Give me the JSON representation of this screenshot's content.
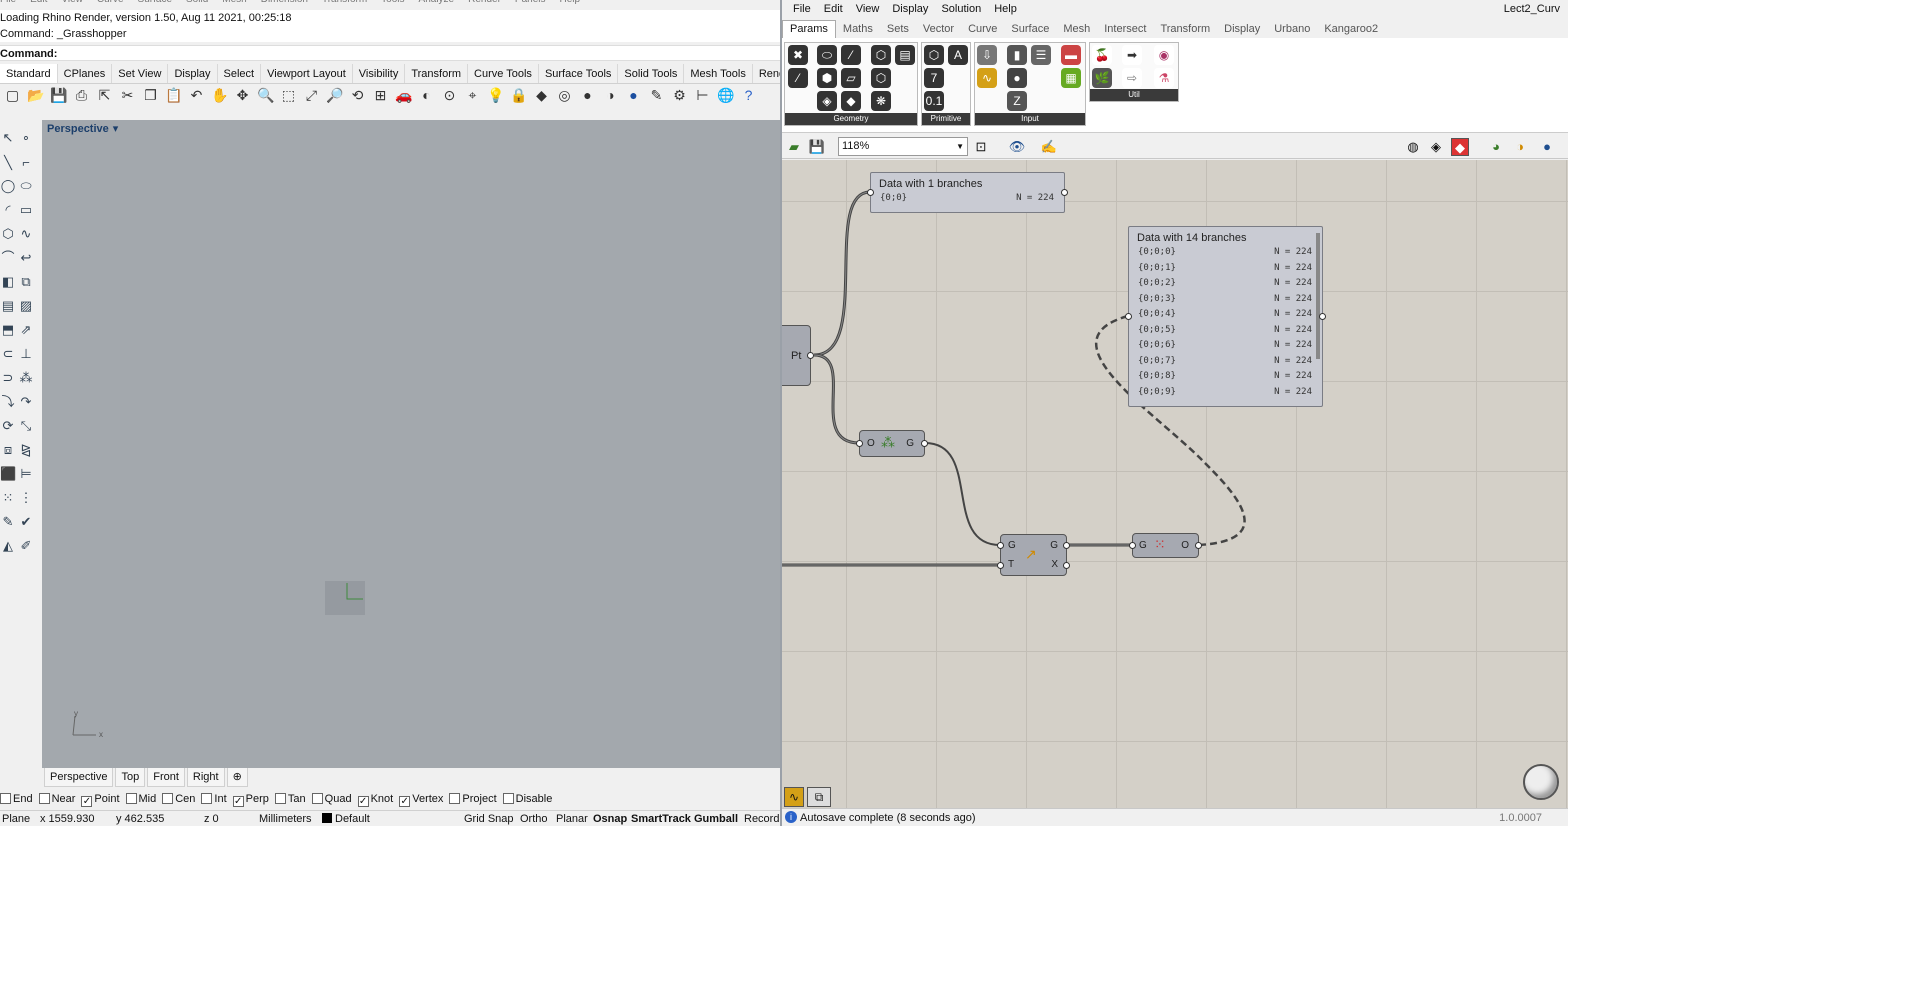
{
  "rhino": {
    "menus": [
      "File",
      "Edit",
      "View",
      "Curve",
      "Surface",
      "Solid",
      "Mesh",
      "Dimension",
      "Transform",
      "Tools",
      "Analyze",
      "Render",
      "Panels",
      "Help"
    ],
    "history_line": "Loading Rhino Render, version 1.50, Aug 11 2021, 00:25:18",
    "command_history": "Command: _Grasshopper",
    "command_prompt": "Command:",
    "toolbar_tabs": [
      "Standard",
      "CPlanes",
      "Set View",
      "Display",
      "Select",
      "Viewport Layout",
      "Visibility",
      "Transform",
      "Curve Tools",
      "Surface Tools",
      "Solid Tools",
      "Mesh Tools",
      "Render"
    ],
    "viewport_name": "Perspective",
    "viewport_dropdown": "▾",
    "viewport_tabs": [
      "Perspective",
      "Top",
      "Front",
      "Right"
    ],
    "add_tab": "⊕",
    "axis_y": "y",
    "axis_x": "x",
    "osnaps": [
      {
        "label": "End",
        "checked": false
      },
      {
        "label": "Near",
        "checked": false
      },
      {
        "label": "Point",
        "checked": true
      },
      {
        "label": "Mid",
        "checked": false
      },
      {
        "label": "Cen",
        "checked": false
      },
      {
        "label": "Int",
        "checked": false
      },
      {
        "label": "Perp",
        "checked": true
      },
      {
        "label": "Tan",
        "checked": false
      },
      {
        "label": "Quad",
        "checked": false
      },
      {
        "label": "Knot",
        "checked": true
      },
      {
        "label": "Vertex",
        "checked": true
      },
      {
        "label": "Project",
        "checked": false
      },
      {
        "label": "Disable",
        "checked": false
      }
    ],
    "status": {
      "cplane": "Plane",
      "x": "x 1559.930",
      "y": "y 462.535",
      "z": "z 0",
      "units": "Millimeters",
      "layer": "Default",
      "grid_snap": "Grid Snap",
      "ortho": "Ortho",
      "planar": "Planar",
      "osnap": "Osnap",
      "smarttrack": "SmartTrack",
      "gumball": "Gumball",
      "record": "Record"
    }
  },
  "gh": {
    "menus": [
      "File",
      "Edit",
      "View",
      "Display",
      "Solution",
      "Help"
    ],
    "doc_title": "Lect2_Curv",
    "tabs": [
      "Params",
      "Maths",
      "Sets",
      "Vector",
      "Curve",
      "Surface",
      "Mesh",
      "Intersect",
      "Transform",
      "Display",
      "Urbano",
      "Kangaroo2"
    ],
    "groups": [
      "Geometry",
      "Primitive",
      "Input",
      "Util"
    ],
    "zoom": "118%",
    "panel1": {
      "title": "Data with 1 branches",
      "rows": [
        {
          "path": "{0;0}",
          "count": "N = 224"
        }
      ]
    },
    "panel2": {
      "title": "Data with 14 branches",
      "rows": [
        {
          "path": "{0;0;0}",
          "count": "N = 224"
        },
        {
          "path": "{0;0;1}",
          "count": "N = 224"
        },
        {
          "path": "{0;0;2}",
          "count": "N = 224"
        },
        {
          "path": "{0;0;3}",
          "count": "N = 224"
        },
        {
          "path": "{0;0;4}",
          "count": "N = 224"
        },
        {
          "path": "{0;0;5}",
          "count": "N = 224"
        },
        {
          "path": "{0;0;6}",
          "count": "N = 224"
        },
        {
          "path": "{0;0;7}",
          "count": "N = 224"
        },
        {
          "path": "{0;0;8}",
          "count": "N = 224"
        },
        {
          "path": "{0;0;9}",
          "count": "N = 224"
        }
      ]
    },
    "pt_label": "Pt",
    "comp_group": {
      "in": "O",
      "out": "G"
    },
    "comp_move": {
      "in1": "G",
      "in2": "T",
      "out1": "G",
      "out2": "X"
    },
    "comp_ungroup": {
      "in": "G",
      "out": "O"
    },
    "autosave": "Autosave complete (8 seconds ago)",
    "version": "1.0.0007"
  }
}
